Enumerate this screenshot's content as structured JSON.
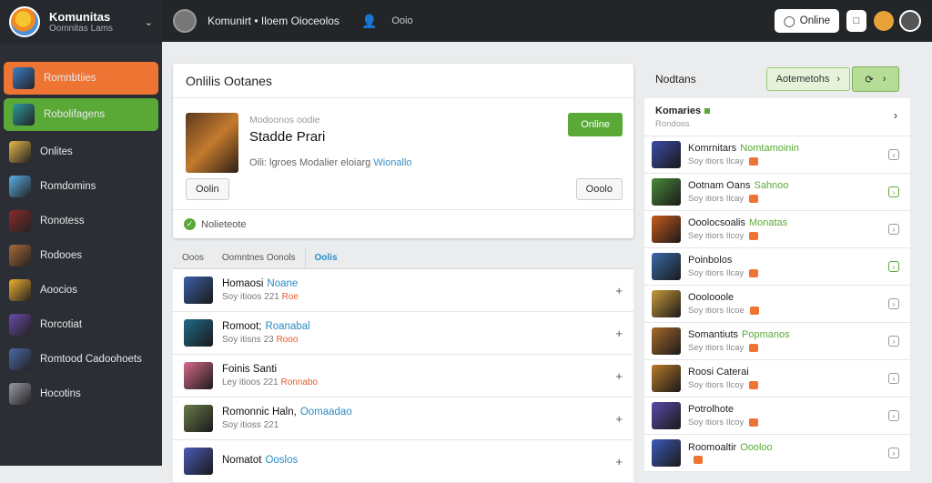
{
  "sidebar": {
    "title": "Komunitas",
    "subtitle": "Oomnitas Lams",
    "items": [
      {
        "label": "Romnbtiies",
        "color": "#3b7fc9"
      },
      {
        "label": "Robolifagens",
        "color": "#2f9aa0"
      },
      {
        "label": "Onlites",
        "color": "#e9b84a"
      },
      {
        "label": "Romdomins",
        "color": "#5ab0e8"
      },
      {
        "label": "Ronotess",
        "color": "#8a2a2a"
      },
      {
        "label": "Rodooes",
        "color": "#a86a3a"
      },
      {
        "label": "Aoocios",
        "color": "#f0b030"
      },
      {
        "label": "Rorcotiat",
        "color": "#6a4aa8"
      },
      {
        "label": "Romtood Cadoohoets",
        "color": "#4a6aa8"
      },
      {
        "label": "Hocotins",
        "color": "#9a9aaa"
      }
    ]
  },
  "topbar": {
    "title": "Komunirt • Iloem Oioceolos",
    "user_label": "Ooio",
    "online_label": "Online"
  },
  "main": {
    "card_title": "Onlilis Ootanes",
    "game_subtitle": "Modoonos oodie",
    "game_title": "Stadde Prari",
    "game_desc": "Oili: lgroes Modalier eloiarg",
    "game_desc_link": "Wionallo",
    "online_button": "Online",
    "left_button": "Oolin",
    "right_button": "Ooolo",
    "status_text": "Nolieteote",
    "tabs": [
      "Ooos",
      "Oomntnes Oonols",
      "Oolis"
    ],
    "rows": [
      {
        "name": "Homaosi",
        "tag": "Noane",
        "meta": "Soy itioos 221",
        "badge": "Roe",
        "img": "#3b5fa8"
      },
      {
        "name": "Romoot;",
        "tag": "Roanabal",
        "meta": "Soy itisns 23",
        "badge": "Rooo",
        "img": "#1e6a8a"
      },
      {
        "name": "Foinis Santi",
        "tag": "",
        "meta": "Ley itioos 221",
        "badge": "Ronnabo",
        "img": "#d86a8a"
      },
      {
        "name": "Romonnic Haln,",
        "tag": "Oomaadao",
        "meta": "Soy itioss 221",
        "badge": "",
        "img": "#6a7a4a"
      },
      {
        "name": "Nomatot",
        "tag": "Ooslos",
        "meta": "",
        "badge": "",
        "img": "#4a5ab8"
      }
    ]
  },
  "right": {
    "header": "Nodtans",
    "auto_button": "Aotemetohs",
    "card_title": "Komaries",
    "card_sub": "Rondoss",
    "rows": [
      {
        "name": "Komrnitars",
        "tag": "Nomtamoinin",
        "meta": "Soy itiors Ilcay",
        "img": "#3b4aa8",
        "btn": "grey"
      },
      {
        "name": "Ootnam Oans",
        "tag": "Sahnoo",
        "meta": "Soy itiors Ilcay",
        "img": "#4a8a3a",
        "btn": "green"
      },
      {
        "name": "Ooolocsoalis",
        "tag": "Monatas",
        "meta": "Sey itiors Ilcoy",
        "img": "#c85a1a",
        "btn": "grey"
      },
      {
        "name": "Poinbolos",
        "tag": "",
        "meta": "Soy itiors Ilcay",
        "img": "#3a6aa8",
        "btn": "green"
      },
      {
        "name": "Ooolooole",
        "tag": "",
        "meta": "Soy itiors Ilcoe",
        "img": "#c89a3a",
        "btn": "grey"
      },
      {
        "name": "Somantiuts",
        "tag": "Popmanos",
        "meta": "Sey itiors Ilcay",
        "img": "#a86a2a",
        "btn": "grey"
      },
      {
        "name": "Roosi Caterai",
        "tag": "",
        "meta": "Soy itiors Ilcoy",
        "img": "#b87a2a",
        "btn": "grey"
      },
      {
        "name": "Potrolhote",
        "tag": "",
        "meta": "Soy itiors Ilcoy",
        "img": "#5a4aa8",
        "btn": "grey"
      },
      {
        "name": "Roomoaltir",
        "tag": "Oooloo",
        "meta": "",
        "img": "#3a5ab8",
        "btn": "grey"
      }
    ]
  },
  "colors": {
    "orange": "#ee7433",
    "green": "#5aa937",
    "blue": "#2a8bc6",
    "sidebar": "#2b2f35"
  }
}
